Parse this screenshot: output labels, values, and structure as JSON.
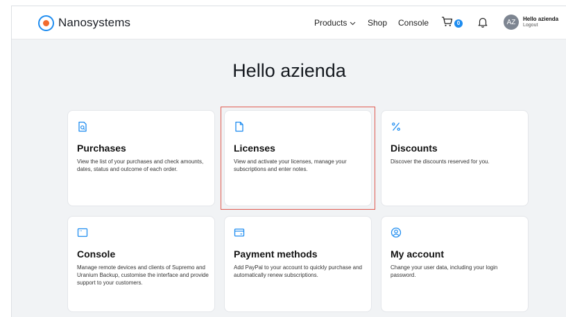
{
  "header": {
    "brand": "Nanosystems",
    "nav": {
      "products": "Products",
      "shop": "Shop",
      "console": "Console"
    },
    "cart_count": "0",
    "user": {
      "initials": "AZ",
      "greeting": "Hello azienda",
      "logout": "Logout"
    }
  },
  "main": {
    "title": "Hello azienda",
    "cards": [
      {
        "title": "Purchases",
        "desc": "View the list of your purchases and check amounts, dates, status and outcome of each order.",
        "icon": "receipt-icon"
      },
      {
        "title": "Licenses",
        "desc": "View and activate your licenses, manage your subscriptions and enter notes.",
        "icon": "document-icon"
      },
      {
        "title": "Discounts",
        "desc": "Discover the discounts reserved for you.",
        "icon": "percent-icon"
      },
      {
        "title": "Console",
        "desc": "Manage remote devices and clients of Supremo and Uranium Backup, customise the interface and provide support to your customers.",
        "icon": "window-icon"
      },
      {
        "title": "Payment methods",
        "desc": "Add PayPal to your account to quickly purchase and automatically renew subscriptions.",
        "icon": "credit-card-icon"
      },
      {
        "title": "My account",
        "desc": "Change your user data, including your login password.",
        "icon": "user-circle-icon"
      }
    ]
  },
  "colors": {
    "accent": "#1d8cf0",
    "logo_dot": "#f26b2e",
    "background": "#f1f3f5",
    "highlight": "#e05a4f"
  }
}
